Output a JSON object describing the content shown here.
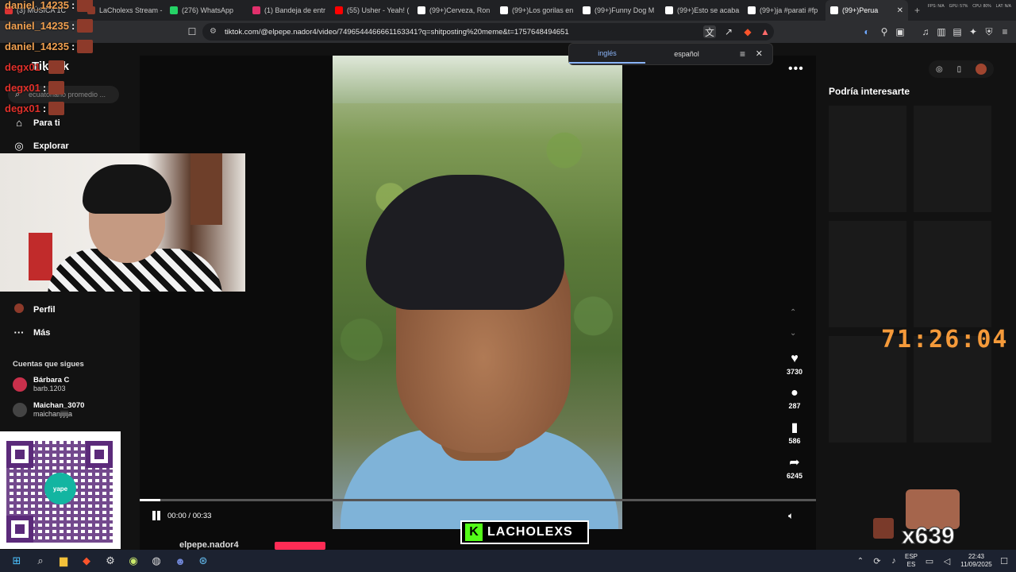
{
  "browser": {
    "tabs": [
      {
        "label": "(3) MÚSICA 1C",
        "color": "#d33"
      },
      {
        "label": "LaCholexs Stream -",
        "color": "#8d3a2a"
      },
      {
        "label": "(276) WhatsApp",
        "color": "#25d366"
      },
      {
        "label": "(1) Bandeja de entr",
        "color": "#e1306c"
      },
      {
        "label": "(55) Usher - Yeah! (",
        "color": "#ff0000"
      },
      {
        "label": "(99+)Cerveza, Ron",
        "color": "#ffffff"
      },
      {
        "label": "(99+)Los gorilas en",
        "color": "#ffffff"
      },
      {
        "label": "(99+)Funny Dog M",
        "color": "#ffffff"
      },
      {
        "label": "(99+)Esto se acaba",
        "color": "#ffffff"
      },
      {
        "label": "(99+)ja #parati #fp",
        "color": "#ffffff"
      },
      {
        "label": "(99+)Perua",
        "color": "#ffffff"
      }
    ],
    "new_tab": "+",
    "sys_stats": [
      "FPS: N/A",
      "GPU: 57%",
      "CPU: 80%",
      "LAT: N/A"
    ],
    "url": "tiktok.com/@elpepe.nador4/video/7496544466661163341?q=shitposting%20meme&t=1757648494651"
  },
  "translate": {
    "lang_from": "inglés",
    "lang_to": "español"
  },
  "tiktok": {
    "logo": "TikTok",
    "search_placeholder": "ecuatoriano promedio ...",
    "nav": {
      "for_you": "Para ti",
      "explore": "Explorar",
      "profile": "Perfil",
      "more": "Más"
    },
    "following_title": "Cuentas que sigues",
    "following": [
      {
        "name": "Bárbara C",
        "user": "barb.1203",
        "color": "#c9304b"
      },
      {
        "name": "Maichan_3070",
        "user": "maichanjijija",
        "color": "#444"
      }
    ],
    "time": "00:00 / 00:33",
    "progress": 0.03,
    "author": "elpepe.nador4",
    "actions": {
      "likes": "3730",
      "comments": "287",
      "saves": "586",
      "shares": "6245"
    },
    "suggestions_title": "Podría interesarte"
  },
  "stream": {
    "chat": [
      {
        "user": "daniel_14235",
        "sep": ":",
        "color": "#f0a050"
      },
      {
        "user": "daniel_14235",
        "sep": ":",
        "color": "#f0a050"
      },
      {
        "user": "daniel_14235",
        "sep": ":",
        "color": "#f0a050"
      },
      {
        "user": "degx01",
        "sep": ":",
        "color": "#e0302a"
      },
      {
        "user": "degx01",
        "sep": ":",
        "color": "#e0302a"
      },
      {
        "user": "degx01",
        "sep": ":",
        "color": "#e0302a"
      }
    ],
    "timer": "71:26:04",
    "brand_k": "K",
    "brand_name": "LACHOLEXS",
    "counter": "x639",
    "qr_label": "yape"
  },
  "taskbar": {
    "lang": "ESP",
    "region": "ES",
    "time": "22:43",
    "date": "11/09/2025"
  }
}
